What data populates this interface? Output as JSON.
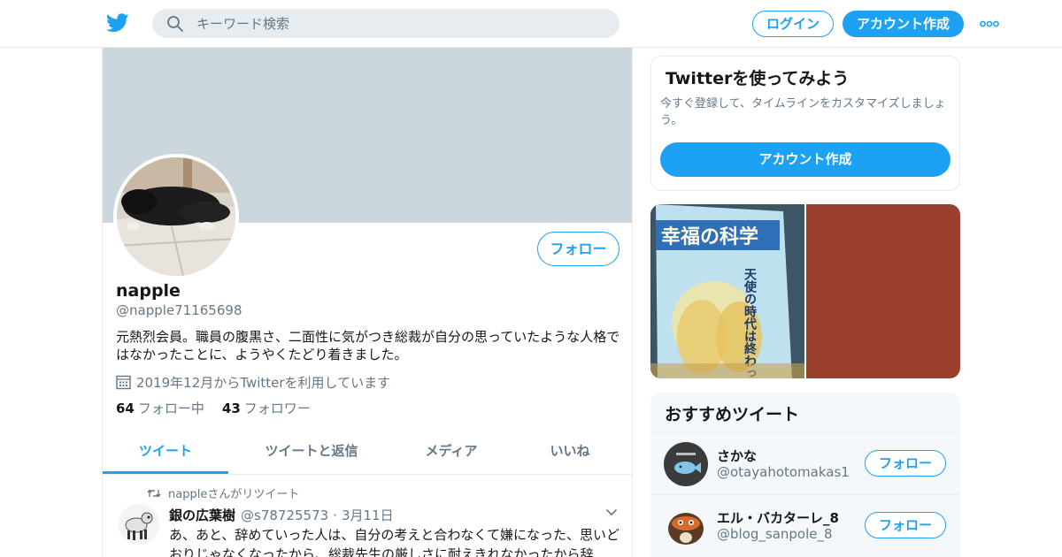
{
  "header": {
    "search_placeholder": "キーワード検索",
    "login_label": "ログイン",
    "signup_label": "アカウント作成",
    "icons": {
      "logo": "twitter-bird-icon",
      "search": "search-icon",
      "more": "more-dots-icon"
    }
  },
  "profile": {
    "follow_label": "フォロー",
    "name": "napple",
    "handle": "@napple71165698",
    "bio": "元熱烈会員。職員の腹黒さ、二面性に気がつき総裁が自分の思っていたような人格ではなかったことに、ようやくたどり着きました。",
    "joined": "2019年12月からTwitterを利用しています",
    "following_count": "64",
    "following_label": "フォロー中",
    "followers_count": "43",
    "followers_label": "フォロワー"
  },
  "tabs": [
    {
      "label": "ツイート",
      "active": true
    },
    {
      "label": "ツイートと返信",
      "active": false
    },
    {
      "label": "メディア",
      "active": false
    },
    {
      "label": "いいね",
      "active": false
    }
  ],
  "tweet": {
    "retweet_context": "nappleさんがリツイート",
    "author_name": "銀の広葉樹",
    "author_handle": "@s78725573",
    "separator": "·",
    "date": "3月11日",
    "text": "あ、あと、辞めていった人は、自分の考えと合わなくて嫌になった、思いどおりじゃなくなったから、総裁先生の厳しさに耐えきれなかったから辞"
  },
  "signup_card": {
    "title": "Twitterを使ってみよう",
    "text": "今すぐ登録して、タイムラインをカスタマイズしましょう。",
    "button_label": "アカウント作成"
  },
  "media": {
    "magazine_title": "幸福の科学",
    "magazine_headline": "天使の時代は終わった"
  },
  "recommended": {
    "title": "おすすめツイート",
    "accounts": [
      {
        "name": "さかな",
        "handle": "@otayahotomakas1",
        "follow_label": "フォロー"
      },
      {
        "name": "エル・バカターレ_8",
        "handle": "@blog_sanpole_8",
        "follow_label": "フォロー"
      }
    ]
  },
  "colors": {
    "accent": "#1da1f2",
    "banner": "#ccd6dd",
    "muted": "#657786",
    "text": "#14171a"
  }
}
